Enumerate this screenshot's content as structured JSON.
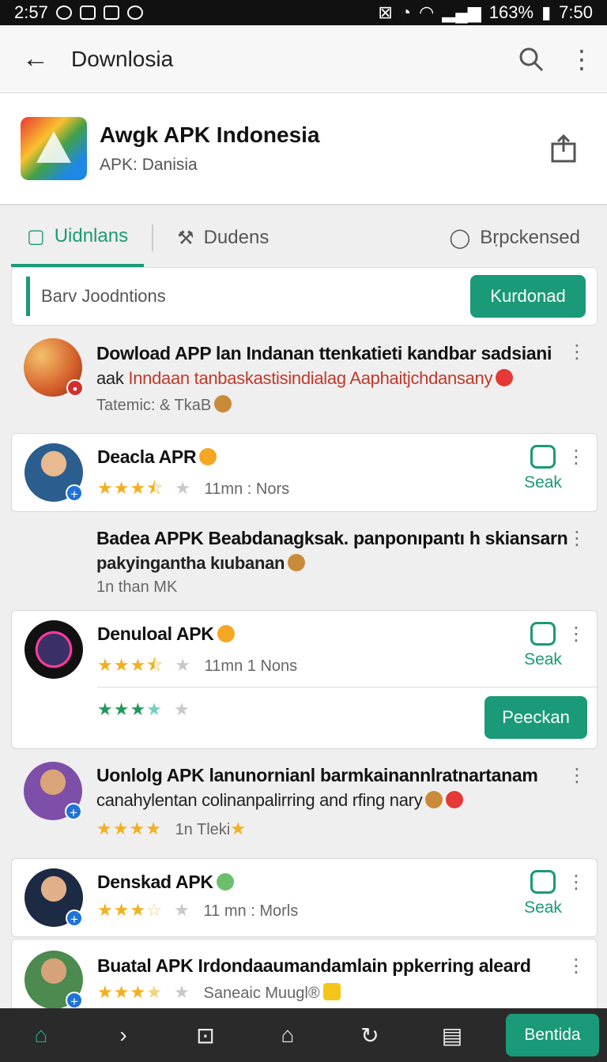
{
  "status_bar": {
    "time_left": "2:57",
    "battery": "163%",
    "time_right": "7:50"
  },
  "appbar": {
    "title": "Downlosia"
  },
  "app": {
    "name": "Awgk APK Indonesia",
    "sub": "APK: Danisia"
  },
  "tabs": [
    {
      "label": "Uidnlans"
    },
    {
      "label": "Dudens"
    },
    {
      "label": "Bṛpckensed"
    }
  ],
  "filter": {
    "label": "Barv Joodntions",
    "button": "Kurdonad"
  },
  "items": [
    {
      "title": "Dowload APP lan Indanan ttenkatieti kandbar sadsiani",
      "line2_a": "aak ",
      "line2_red": "Inndaan tanbaskastisindialag Aaphaitjchdansany",
      "meta": "Tatemic: & TkaB"
    },
    {
      "title": "Deacla APR",
      "meta": "11mn : Nors",
      "action": "Seak"
    },
    {
      "title": "Badea APPK Beabdanagksak. panponıpantı h skiansarn",
      "line2": "pakyingantha kıubanan",
      "meta": "1n than MK"
    },
    {
      "title": "Denuloal APK",
      "meta": "11mn 1 Nons",
      "action": "Seak",
      "button": "Peeckan"
    },
    {
      "title": "Uonlolg APK lanunornianl barmkainannlratnartanam",
      "line2": "canahylentan colinanpalirring and rfing nary",
      "meta": "1n Tleki"
    },
    {
      "title": "Denskad APK",
      "meta": "11 mn : Morls",
      "action": "Seak"
    },
    {
      "title": "Buatal APK Irdondaaumandamlain ppkerring aleard",
      "meta": "Saneaic Muugl®"
    }
  ],
  "bottom_nav": {
    "button": "Bentida"
  },
  "colors": {
    "accent": "#1a9a78",
    "star": "#f2b01e",
    "red_text": "#c0392b"
  }
}
